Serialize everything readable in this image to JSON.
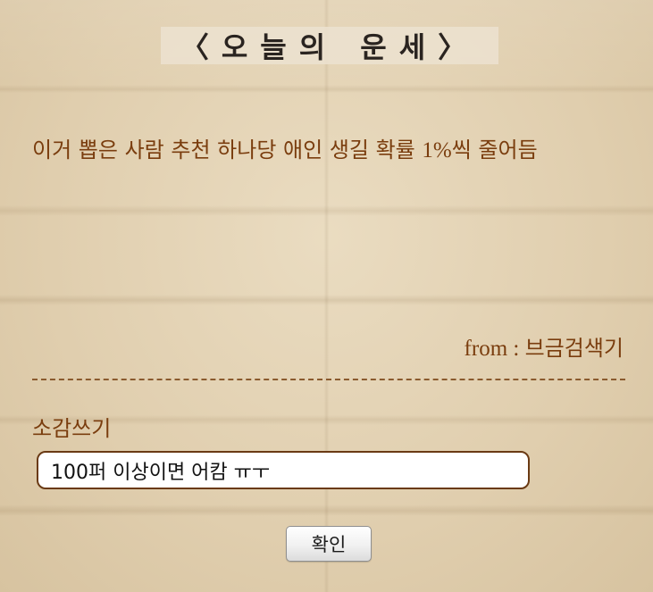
{
  "header": {
    "title": "〈오늘의 운세〉"
  },
  "fortune": {
    "message_before": "이거 뽑은 사람 추천 하나당 애인 생길 확률 ",
    "message_number": "1%",
    "message_after": "씩 줄어듬",
    "from_label": "from : ",
    "from_name": "브금검색기"
  },
  "review": {
    "label": "소감쓰기",
    "input_value": "100퍼 이상이면 어캄 ㅠㅜ"
  },
  "actions": {
    "confirm_label": "확인"
  }
}
